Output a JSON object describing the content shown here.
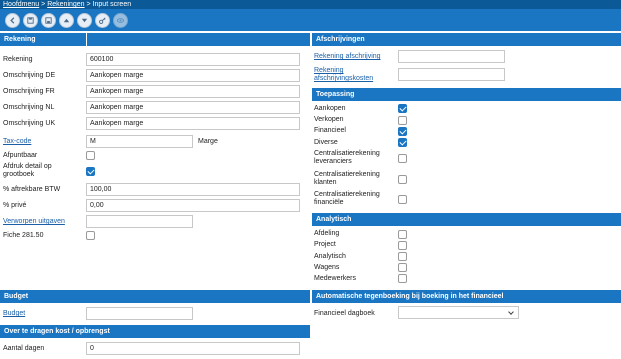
{
  "breadcrumb": {
    "home": "Hoofdmenu",
    "sep1": ">",
    "accounts": "Rekeningen",
    "sep2": ">",
    "current": "Input screen"
  },
  "toolbar": {
    "icons": [
      "back-icon",
      "save-icon",
      "save-as-icon",
      "arrow-up-icon",
      "arrow-down-icon",
      "key-icon",
      "view-icon"
    ]
  },
  "rekening": {
    "title": "Rekening",
    "rows": [
      {
        "label": "Rekening",
        "value": "600100"
      },
      {
        "label": "Omschrijving DE",
        "value": "Aankopen marge"
      },
      {
        "label": "Omschrijving FR",
        "value": "Aankopen marge"
      },
      {
        "label": "Omschrijving NL",
        "value": "Aankopen marge"
      },
      {
        "label": "Omschrijving UK",
        "value": "Aankopen marge"
      }
    ],
    "taxcode": {
      "label": "Tax-code",
      "value": "M",
      "desc": "Marge"
    },
    "afpuntbaar": {
      "label": "Afpuntbaar",
      "checked": false
    },
    "afdruk": {
      "label_1": "Afdruk detail op",
      "label_2": "grootboek",
      "checked": true
    },
    "aftrekbare": {
      "label": "% aftrekbare BTW",
      "value": "100,00"
    },
    "prive": {
      "label": "% privé",
      "value": "0,00"
    },
    "verworpen": {
      "label": "Verworpen uitgaven",
      "value": ""
    },
    "fiche": {
      "label": "Fiche 281.50",
      "checked": false
    }
  },
  "afschrijvingen": {
    "title": "Afschrijvingen",
    "rekening_afschrijving": "Rekening afschrijving",
    "rekening_kosten_1": "Rekening",
    "rekening_kosten_2": "afschrijvingskosten"
  },
  "toepassing": {
    "title": "Toepassing",
    "items": [
      {
        "l1": "Aankopen",
        "l2": "",
        "checked": true
      },
      {
        "l1": "Verkopen",
        "l2": "",
        "checked": false
      },
      {
        "l1": "Financieel",
        "l2": "",
        "checked": true
      },
      {
        "l1": "Diverse",
        "l2": "",
        "checked": true
      },
      {
        "l1": "Centralisatierekening",
        "l2": "leveranciers",
        "checked": false
      },
      {
        "l1": "Centralisatierekening",
        "l2": "klanten",
        "checked": false
      },
      {
        "l1": "Centralisatierekening",
        "l2": "financiële",
        "checked": false
      }
    ]
  },
  "analytisch": {
    "title": "Analytisch",
    "items": [
      {
        "label": "Afdeling",
        "checked": false
      },
      {
        "label": "Project",
        "checked": false
      },
      {
        "label": "Analytisch",
        "checked": false
      },
      {
        "label": "Wagens",
        "checked": false
      },
      {
        "label": "Medewerkers",
        "checked": false
      }
    ]
  },
  "budget": {
    "title": "Budget",
    "label": "Budget",
    "value": ""
  },
  "tegenboeking": {
    "title": "Automatische tegenboeking bij boeking in het financieel",
    "label": "Financieel dagboek",
    "value": ""
  },
  "overdragen": {
    "title": "Over te dragen kost / opbrengst",
    "label": "Aantal dagen",
    "value": "0"
  }
}
